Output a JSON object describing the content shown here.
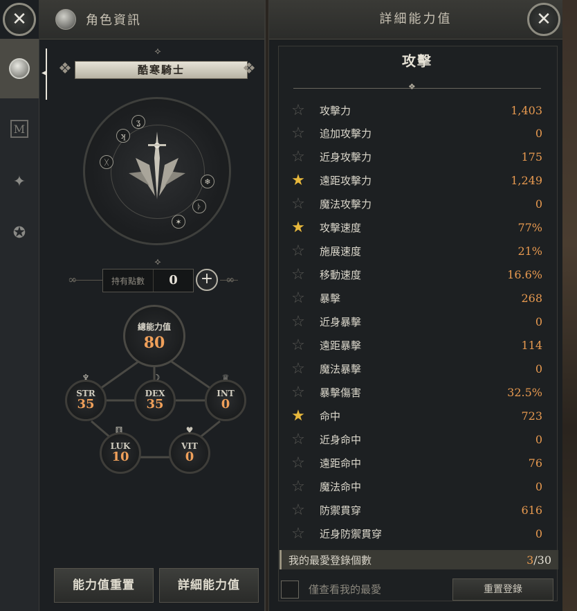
{
  "left_panel": {
    "header_title": "角色資訊",
    "character_class": "酷寒騎士",
    "points_label": "持有點數",
    "points_value": "0",
    "total_label": "總能力值",
    "total_value": "80",
    "stats": [
      {
        "key": "STR",
        "value": "35"
      },
      {
        "key": "DEX",
        "value": "35"
      },
      {
        "key": "INT",
        "value": "0"
      },
      {
        "key": "LUK",
        "value": "10"
      },
      {
        "key": "VIT",
        "value": "0"
      }
    ],
    "buttons": {
      "reset_stats": "能力值重置",
      "detail_stats": "詳細能力值"
    },
    "tabs": [
      "profile-icon",
      "m-emblem-icon",
      "shuriken-icon",
      "medal-icon"
    ]
  },
  "right_panel": {
    "header_title": "詳細能力值",
    "section_title": "攻擊",
    "rows": [
      {
        "label": "攻擊力",
        "value": "1,403",
        "favorite": false
      },
      {
        "label": "追加攻擊力",
        "value": "0",
        "favorite": false
      },
      {
        "label": "近身攻擊力",
        "value": "175",
        "favorite": false
      },
      {
        "label": "遠距攻擊力",
        "value": "1,249",
        "favorite": true
      },
      {
        "label": "魔法攻擊力",
        "value": "0",
        "favorite": false
      },
      {
        "label": "攻擊速度",
        "value": "77%",
        "favorite": true
      },
      {
        "label": "施展速度",
        "value": "21%",
        "favorite": false
      },
      {
        "label": "移動速度",
        "value": "16.6%",
        "favorite": false
      },
      {
        "label": "暴擊",
        "value": "268",
        "favorite": false
      },
      {
        "label": "近身暴擊",
        "value": "0",
        "favorite": false
      },
      {
        "label": "遠距暴擊",
        "value": "114",
        "favorite": false
      },
      {
        "label": "魔法暴擊",
        "value": "0",
        "favorite": false
      },
      {
        "label": "暴擊傷害",
        "value": "32.5%",
        "favorite": false
      },
      {
        "label": "命中",
        "value": "723",
        "favorite": true
      },
      {
        "label": "近身命中",
        "value": "0",
        "favorite": false
      },
      {
        "label": "遠距命中",
        "value": "76",
        "favorite": false
      },
      {
        "label": "魔法命中",
        "value": "0",
        "favorite": false
      },
      {
        "label": "防禦貫穿",
        "value": "616",
        "favorite": false
      },
      {
        "label": "近身防禦貫穿",
        "value": "0",
        "favorite": false
      }
    ],
    "favorites": {
      "label": "我的最愛登錄個數",
      "current": "3",
      "max": "/30"
    },
    "only_favorites_label": "僅查看我的最愛",
    "reset_favorites_button": "重置登錄"
  },
  "colors": {
    "accent_value": "#e89a50",
    "favorite_star": "#e8b83c",
    "panel_bg": "#1b1e20"
  }
}
